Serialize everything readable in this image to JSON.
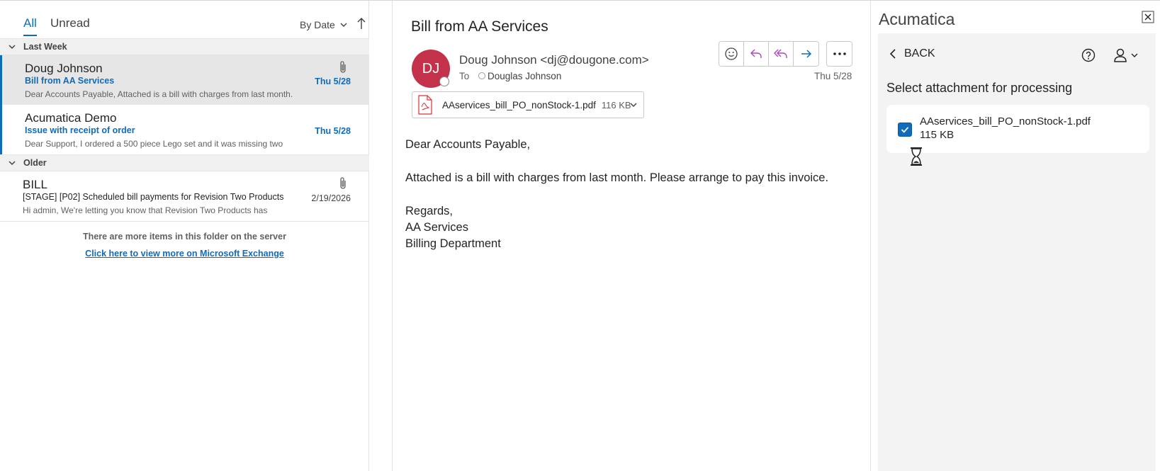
{
  "list": {
    "tabs": [
      {
        "label": "All",
        "active": true
      },
      {
        "label": "Unread",
        "active": false
      }
    ],
    "sort_label": "By Date",
    "groups": [
      {
        "label": "Last Week"
      },
      {
        "label": "Older"
      }
    ],
    "messages": [
      {
        "sender": "Doug Johnson",
        "subject": "Bill from AA Services",
        "preview": "Dear Accounts Payable,  Attached is a bill with charges from last month.",
        "date": "Thu 5/28",
        "has_attachment": true,
        "selected": true
      },
      {
        "sender": "Acumatica Demo",
        "subject": "Issue with receipt of order",
        "preview": "Dear Support,   I ordered a 500 piece Lego set and it was missing two",
        "date": "Thu 5/28",
        "has_attachment": false,
        "selected": false
      },
      {
        "sender": "BILL",
        "subject": "[STAGE] [P02] Scheduled bill payments for Revision Two Products",
        "preview": "Hi admin,  We're letting you know that Revision Two Products has",
        "date": "2/19/2026",
        "has_attachment": true,
        "selected": false
      }
    ],
    "more_note": "There are more items in this folder on the server",
    "more_link": "Click here to view more on Microsoft Exchange"
  },
  "reading": {
    "subject": "Bill from AA Services",
    "avatar_initials": "DJ",
    "from": "Doug Johnson <dj@dougone.com>",
    "to_label": "To",
    "to_name": "Douglas Johnson",
    "date": "Thu 5/28",
    "actions": [
      "emoji-icon",
      "reply-icon",
      "reply-all-icon",
      "forward-icon",
      "more-icon"
    ],
    "attachment": {
      "name": "AAservices_bill_PO_nonStock-1.pdf",
      "size": "116 KB"
    },
    "body": {
      "greeting": "Dear Accounts Payable,",
      "line1": "Attached is a bill with charges from last month. Please arrange to pay this invoice.",
      "regards": "Regards,",
      "sig1": "AA Services",
      "sig2": "Billing Department"
    }
  },
  "addin": {
    "title": "Acumatica",
    "back_label": "BACK",
    "select_title": "Select attachment for processing",
    "attachment": {
      "name": "AAservices_bill_PO_nonStock-1.pdf",
      "size": "115 KB",
      "checked": true
    }
  },
  "colors": {
    "accent": "#0f6cbd",
    "avatar": "#c4314b",
    "reply_purple": "#b146c2",
    "forward_blue": "#0f6cbd"
  }
}
